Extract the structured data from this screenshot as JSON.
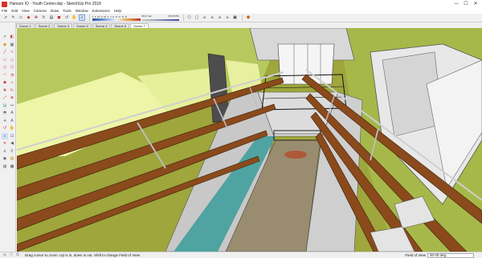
{
  "window": {
    "title": "Hanson IO - Youth Center.skp - SketchUp Pro 2018",
    "minimize": "—",
    "maximize": "☐",
    "close": "✕"
  },
  "menu": [
    "File",
    "Edit",
    "View",
    "Camera",
    "Draw",
    "Tools",
    "Window",
    "Extensions",
    "Help"
  ],
  "toolbar": {
    "shadow_time": "06:27 am",
    "shadow_time_end": "06:25 PM",
    "months": "J F M A M J J A S O N D"
  },
  "scenes": [
    "Scene 1",
    "Scene 2",
    "Scene 3",
    "Scene 5",
    "Scene 4",
    "Scene 6",
    "Scene 7"
  ],
  "active_scene": "Scene 7",
  "status": {
    "hint": "Drag cursor to zoom.  Up is in, down is out. Shift to change Field of View.",
    "vcb_label": "Field of View",
    "vcb_value": "30.00 deg."
  },
  "icons": {
    "left_tools": [
      "select-icon",
      "eraser-icon",
      "paint-bucket-icon",
      "line-icon",
      "pencil-icon",
      "freehand-icon",
      "rectangle-icon",
      "rotated-rectangle-icon",
      "circle-icon",
      "polygon-icon",
      "arc-icon",
      "pie-icon",
      "push-pull-icon",
      "follow-me-icon",
      "move-icon",
      "rotate-icon",
      "scale-icon",
      "offset-icon",
      "tape-measure-icon",
      "dimension-icon",
      "protractor-icon",
      "text-icon",
      "axes-icon",
      "3d-text-icon",
      "orbit-icon",
      "pan-icon",
      "zoom-icon",
      "zoom-window-icon",
      "zoom-extents-icon",
      "previous-view-icon",
      "position-camera-icon",
      "walk-icon",
      "look-around-icon",
      "section-plane-icon",
      "display-section-icon",
      "section-cut-icon",
      "sandbox-icon",
      "smoove-icon",
      "stamp-icon",
      "drape-icon",
      "add-detail-icon",
      "flip-edge-icon"
    ]
  }
}
